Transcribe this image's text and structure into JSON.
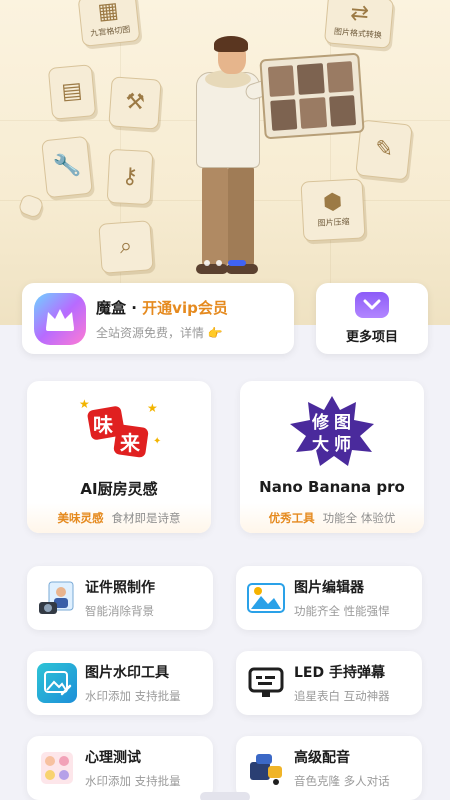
{
  "banner": {
    "tiles": [
      {
        "label": "九宫格切图",
        "icon": "grid-tool-icon"
      },
      {
        "label": "图片格式转换",
        "icon": "format-convert-icon"
      },
      {
        "label": "图片压缩",
        "icon": "compress-icon"
      }
    ],
    "carousel": {
      "count": 3,
      "active_index": 2
    }
  },
  "vip": {
    "app_name": "魔盒",
    "separator": " · ",
    "cta": "开通vip会员",
    "subtitle": "全站资源免费，详情",
    "emoji": "👉",
    "accent": "#e58a1f"
  },
  "more": {
    "label": "更多项目",
    "icon": "chevron-down-icon"
  },
  "features": [
    {
      "art_text_1": "味",
      "art_text_2": "来",
      "title": "AI厨房灵感",
      "tag": "美味灵感",
      "desc": "食材即是诗意"
    },
    {
      "art_text_1": "修",
      "art_text_2": "图",
      "art_text_3": "大",
      "art_text_4": "师",
      "title": "Nano Banana pro",
      "tag": "优秀工具",
      "desc": "功能全 体验优"
    }
  ],
  "tools": [
    {
      "title": "证件照制作",
      "subtitle": "智能消除背景",
      "icon": "id-photo-icon"
    },
    {
      "title": "图片编辑器",
      "subtitle": "功能齐全 性能强悍",
      "icon": "image-editor-icon"
    },
    {
      "title": "图片水印工具",
      "subtitle": "水印添加 支持批量",
      "icon": "watermark-icon"
    },
    {
      "title": "LED 手持弹幕",
      "subtitle": "追星表白 互动神器",
      "icon": "led-screen-icon"
    },
    {
      "title": "心理测试",
      "subtitle": "水印添加 支持批量",
      "icon": "psychology-test-icon"
    },
    {
      "title": "高级配音",
      "subtitle": "音色克隆 多人对话",
      "icon": "voice-dubbing-icon"
    }
  ]
}
